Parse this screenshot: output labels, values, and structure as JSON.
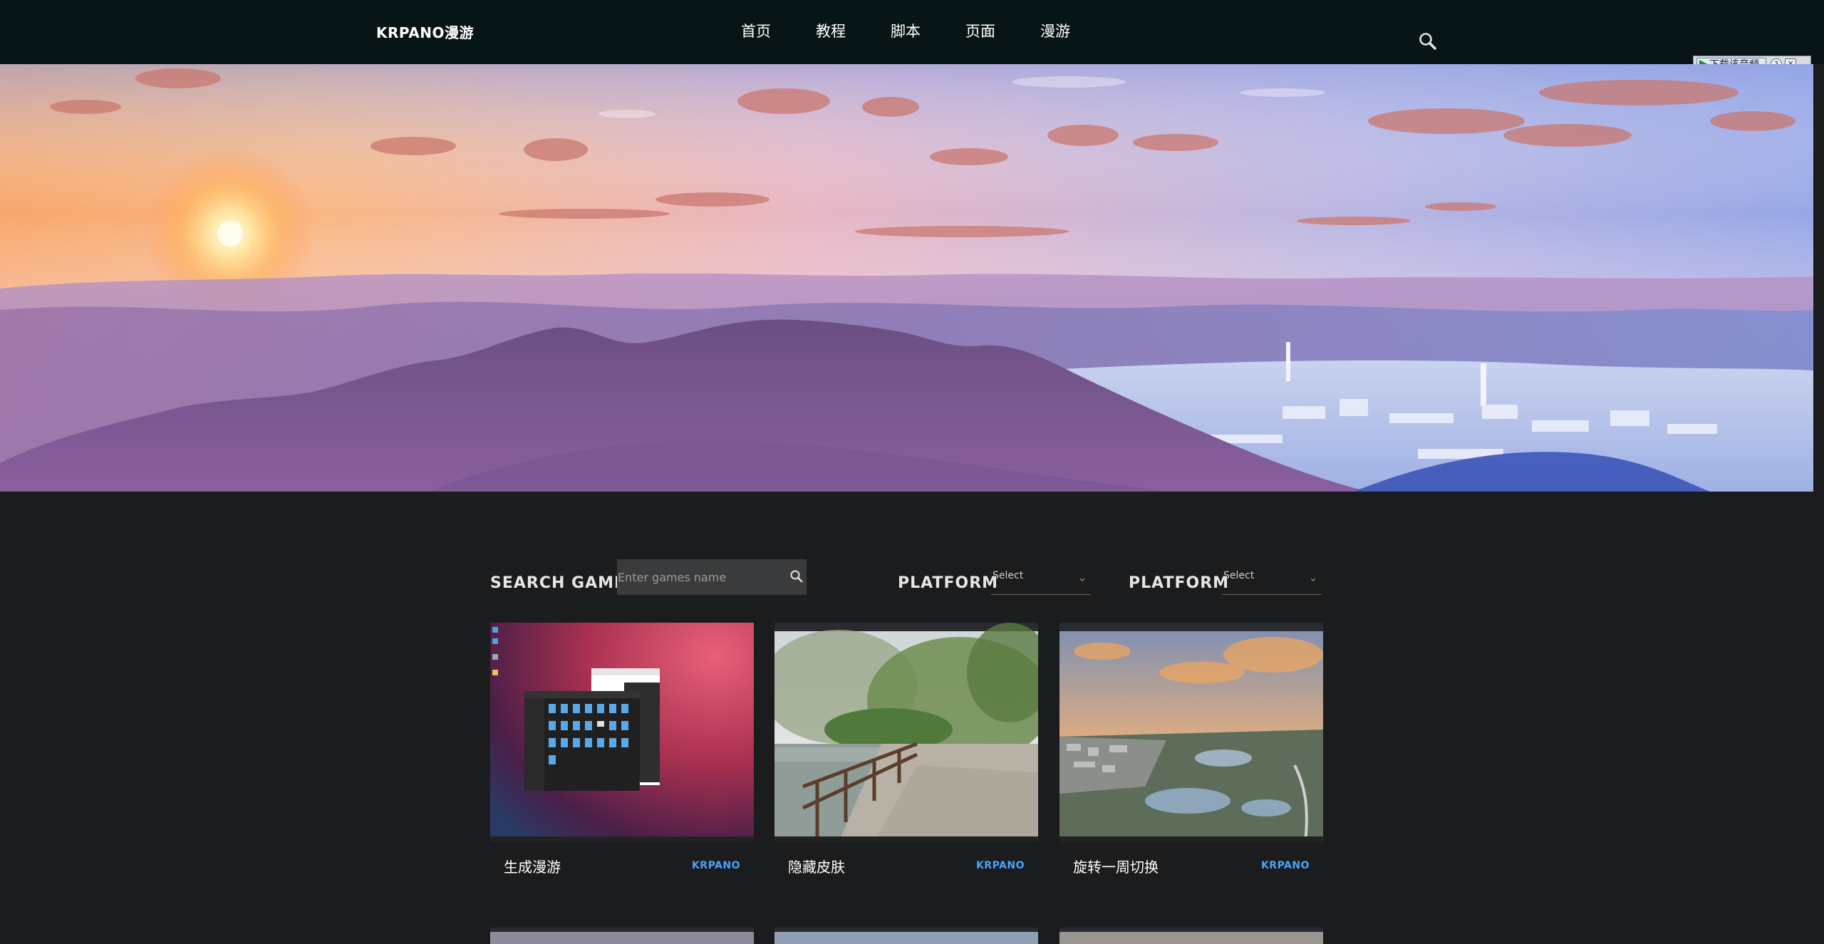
{
  "site": {
    "logo": "KRPANO漫游"
  },
  "nav": {
    "items": [
      "首页",
      "教程",
      "脚本",
      "页面",
      "漫游"
    ]
  },
  "widget": {
    "play_label": "下载该音频",
    "help": "?",
    "close": "X"
  },
  "filters": {
    "search_label": "SEARCH GAMES",
    "search_placeholder": "Enter games name",
    "platform_label_1": "PLATFORM",
    "platform_value_1": "Select",
    "platform_label_2": "PLATFORM",
    "platform_value_2": "Select"
  },
  "cards": [
    {
      "title": "生成漫游",
      "tag": "KRPANO"
    },
    {
      "title": "隐藏皮肤",
      "tag": "KRPANO"
    },
    {
      "title": "旋转一周切换",
      "tag": "KRPANO"
    }
  ],
  "colors": {
    "topbar": "#081517",
    "page_bg": "#1b1c1e",
    "tag": "#4aa3ff"
  }
}
